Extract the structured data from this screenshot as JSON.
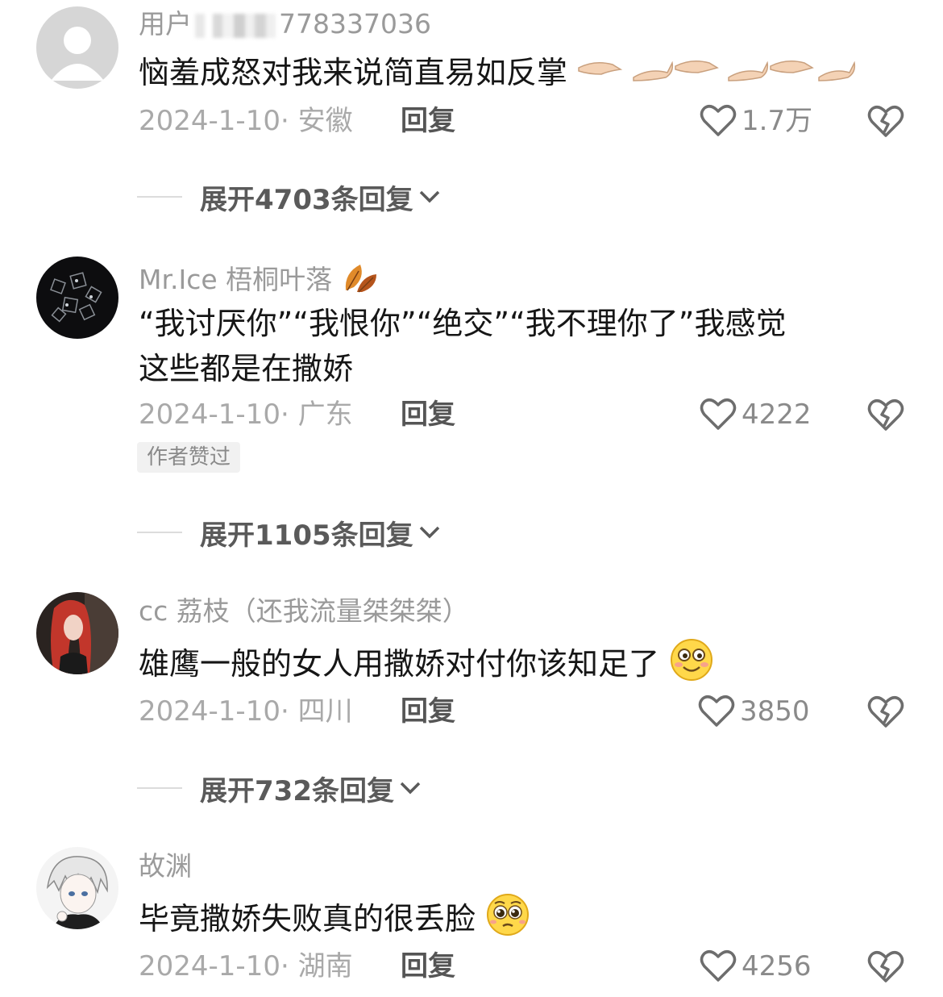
{
  "comments": [
    {
      "username_prefix": "用户",
      "username_suffix": "778337036",
      "text": "恼羞成怒对我来说简直易如反掌",
      "date_location": "2024-1-10· 安徽",
      "reply_label": "回复",
      "likes": "1.7万",
      "expand_label": "展开4703条回复"
    },
    {
      "username": "Mr.Ice 梧桐叶落",
      "text_line1": "“我讨厌你”“我恨你”“绝交”“我不理你了”我感觉",
      "text_line2": "这些都是在撒娇",
      "date_location": "2024-1-10· 广东",
      "reply_label": "回复",
      "likes": "4222",
      "badge": "作者赞过",
      "expand_label": "展开1105条回复"
    },
    {
      "username": "cc 荔枝（还我流量桀桀桀）",
      "text": "雄鹰一般的女人用撒娇对付你该知足了",
      "date_location": "2024-1-10· 四川",
      "reply_label": "回复",
      "likes": "3850",
      "expand_label": "展开732条回复"
    },
    {
      "username": "故渊",
      "text": "毕竟撒娇失败真的很丢脸",
      "date_location": "2024-1-10· 湖南",
      "reply_label": "回复",
      "likes": "4256"
    }
  ],
  "icons": {
    "like": "heart-outline-icon",
    "dislike": "broken-heart-icon",
    "expand": "chevron-down-icon"
  }
}
